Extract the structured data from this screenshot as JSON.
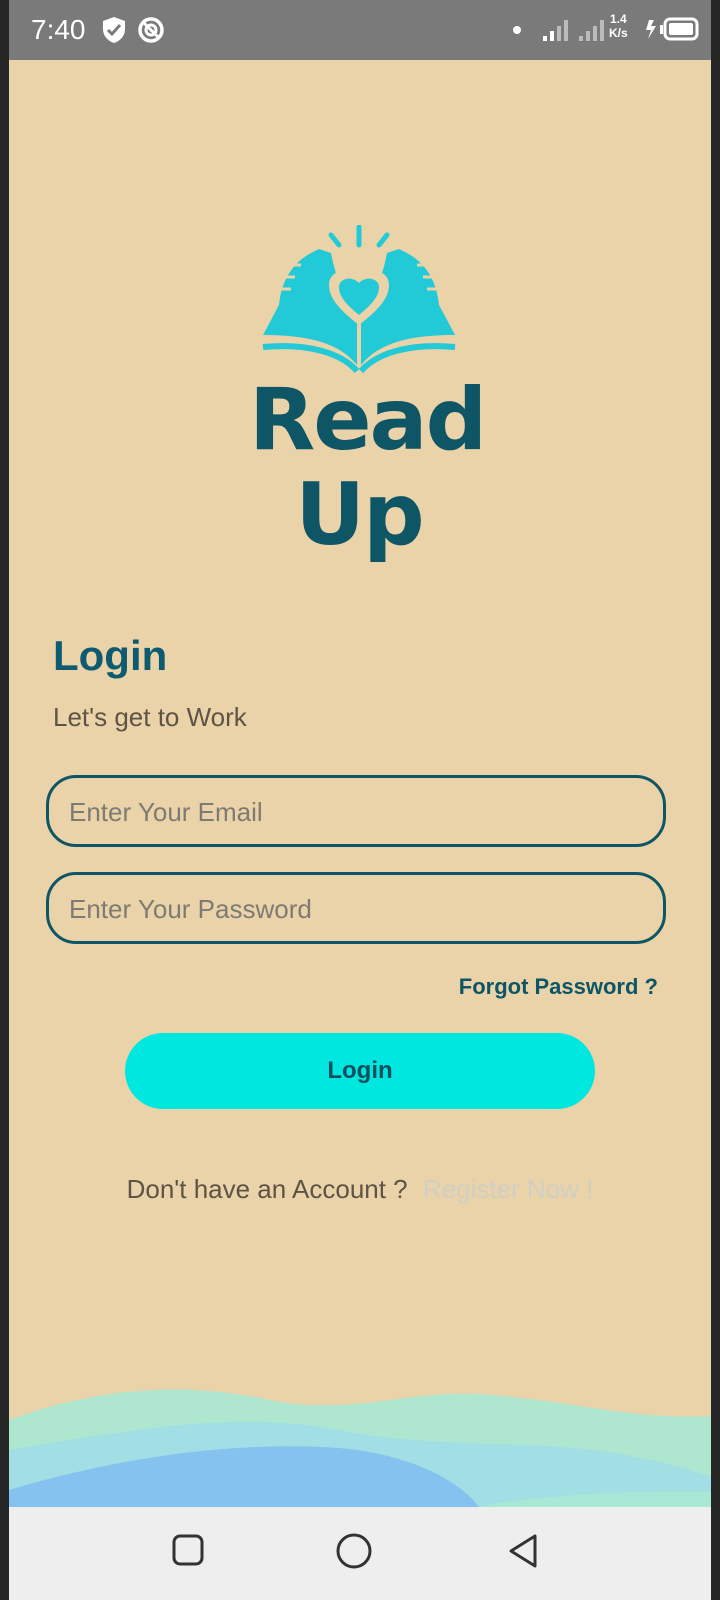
{
  "status_bar": {
    "time": "7:40",
    "network_speed_value": "1.4",
    "network_speed_unit": "K/s",
    "icons": [
      "shield-icon",
      "dnd-icon",
      "dot-icon",
      "signal-icon",
      "signal-icon",
      "charging-icon",
      "battery-icon"
    ]
  },
  "logo": {
    "line1": "Read",
    "line2": "Up",
    "colors": {
      "icon": "#22c9d6",
      "text": "#0e5566"
    }
  },
  "login": {
    "title": "Login",
    "subtitle": "Let's get to Work",
    "email_placeholder": "Enter Your Email",
    "password_placeholder": "Enter Your Password",
    "forgot_password": "Forgot Password ?",
    "button_label": "Login",
    "register_prompt": "Don't have an Account ?",
    "register_link": "Register Now !"
  },
  "colors": {
    "background": "#ead3a9",
    "accent": "#00e7e0",
    "primary_text": "#0e5566",
    "wave_light": "#a8e8d4",
    "wave_blue": "#85c2f0"
  },
  "nav_bar": {
    "icons": [
      "recents-icon",
      "home-icon",
      "back-icon"
    ]
  }
}
